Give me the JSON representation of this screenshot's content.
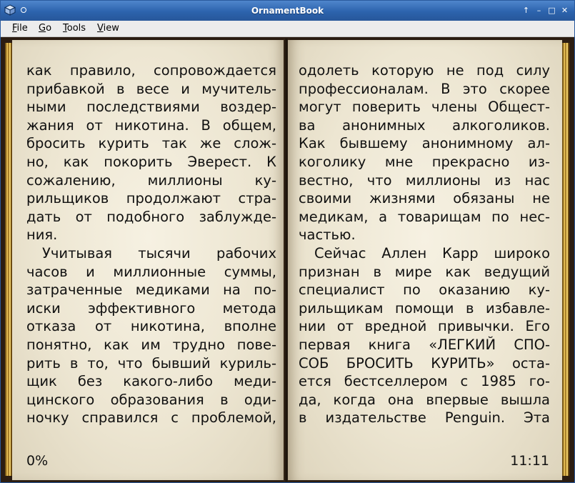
{
  "window": {
    "title": "OrnamentBook",
    "controls": {
      "up": "↑",
      "min": "–",
      "max": "□",
      "close": "✕"
    }
  },
  "menu": [
    {
      "first": "F",
      "rest": "ile"
    },
    {
      "first": "G",
      "rest": "o"
    },
    {
      "first": "T",
      "rest": "ools"
    },
    {
      "first": "V",
      "rest": "iew"
    }
  ],
  "left_page": {
    "lines": [
      {
        "t": "как правило, сопровождается",
        "j": true,
        "i": false
      },
      {
        "t": "прибавкой в весе и мучитель-",
        "j": true,
        "i": false
      },
      {
        "t": "ными последствиями воздер-",
        "j": true,
        "i": false
      },
      {
        "t": "жания от никотина. В общем,",
        "j": true,
        "i": false
      },
      {
        "t": "бросить курить так же слож-",
        "j": true,
        "i": false
      },
      {
        "t": "но, как покорить Эверест. К",
        "j": true,
        "i": false
      },
      {
        "t": "сожалению, миллионы ку-",
        "j": true,
        "i": false
      },
      {
        "t": "рильщиков продолжают стра-",
        "j": true,
        "i": false
      },
      {
        "t": "дать от подобного заблужде-",
        "j": true,
        "i": false
      },
      {
        "t": "ния.",
        "j": false,
        "i": false
      },
      {
        "t": "Учитывая тысячи рабочих",
        "j": true,
        "i": true
      },
      {
        "t": "часов и миллионные суммы,",
        "j": true,
        "i": false
      },
      {
        "t": "затраченные медиками на по-",
        "j": true,
        "i": false
      },
      {
        "t": "иски эффективного метода",
        "j": true,
        "i": false
      },
      {
        "t": "отказа от никотина, вполне",
        "j": true,
        "i": false
      },
      {
        "t": "понятно, как им трудно пове-",
        "j": true,
        "i": false
      },
      {
        "t": "рить в то, что бывший куриль-",
        "j": true,
        "i": false
      },
      {
        "t": "щик без какого-либо меди-",
        "j": true,
        "i": false
      },
      {
        "t": "цинского образования в оди-",
        "j": true,
        "i": false
      },
      {
        "t": "ночку справился с проблемой,",
        "j": true,
        "i": false
      }
    ],
    "footer": "0%"
  },
  "right_page": {
    "lines": [
      {
        "t": "одолеть которую не под силу",
        "j": true,
        "i": false
      },
      {
        "t": "профессионалам. В это скорее",
        "j": true,
        "i": false
      },
      {
        "t": "могут поверить члены Общест-",
        "j": true,
        "i": false
      },
      {
        "t": "ва анонимных алкоголиков.",
        "j": true,
        "i": false
      },
      {
        "t": "Как бывшему анонимному ал-",
        "j": true,
        "i": false
      },
      {
        "t": "коголику мне прекрасно из-",
        "j": true,
        "i": false
      },
      {
        "t": "вестно, что миллионы из нас",
        "j": true,
        "i": false
      },
      {
        "t": "своими жизнями обязаны не",
        "j": true,
        "i": false
      },
      {
        "t": "медикам, а товарищам по нес-",
        "j": true,
        "i": false
      },
      {
        "t": "частью.",
        "j": false,
        "i": false
      },
      {
        "t": "Сейчас Аллен Карр широко",
        "j": true,
        "i": true
      },
      {
        "t": "признан в мире как ведущий",
        "j": true,
        "i": false
      },
      {
        "t": "специалист по оказанию ку-",
        "j": true,
        "i": false
      },
      {
        "t": "рильщикам помощи в избавле-",
        "j": true,
        "i": false
      },
      {
        "t": "нии от вредной привычки. Его",
        "j": true,
        "i": false
      },
      {
        "t": "первая книга «ЛЕГКИЙ СПО-",
        "j": true,
        "i": false
      },
      {
        "t": "СОБ БРОСИТЬ КУРИТЬ» оста-",
        "j": true,
        "i": false
      },
      {
        "t": "ется бестселлером с 1985 го-",
        "j": true,
        "i": false
      },
      {
        "t": "да, когда она впервые вышла",
        "j": true,
        "i": false
      },
      {
        "t": "в издательстве Penguin. Эта",
        "j": true,
        "i": false
      }
    ],
    "footer": "11:11"
  }
}
